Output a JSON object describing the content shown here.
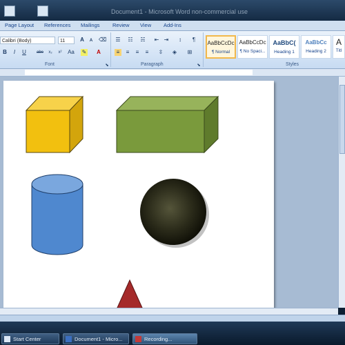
{
  "window": {
    "title": "Document1 - Microsoft Word non-commercial use"
  },
  "ribbon_tabs": [
    {
      "label": "Page Layout"
    },
    {
      "label": "References"
    },
    {
      "label": "Mailings"
    },
    {
      "label": "Review"
    },
    {
      "label": "View"
    },
    {
      "label": "Add-Ins"
    }
  ],
  "font_group": {
    "label": "Font",
    "font_name": "Calibri (Body)",
    "font_size": "11",
    "bold": "B",
    "italic": "I",
    "underline": "U",
    "strike": "abe",
    "subscript": "x₂",
    "superscript": "x²",
    "grow": "A",
    "shrink": "A",
    "font_color": "A"
  },
  "paragraph_group": {
    "label": "Paragraph"
  },
  "styles_group": {
    "label": "Styles",
    "styles": [
      {
        "sample": "AaBbCcDc",
        "name": "¶ Normal",
        "selected": true
      },
      {
        "sample": "AaBbCcDc",
        "name": "¶ No Spaci...",
        "selected": false
      },
      {
        "sample": "AaBbC(",
        "name": "Heading 1",
        "selected": false
      },
      {
        "sample": "AaBbCc",
        "name": "Heading 2",
        "selected": false
      },
      {
        "sample": "A",
        "name": "Titl",
        "selected": false
      }
    ]
  },
  "shapes": {
    "cube_color": "#f2c00f",
    "box_color": "#7a9a3c",
    "cylinder_color": "#4f88cf",
    "sphere_color": "#2b2b1a",
    "triangle_color": "#a52a2a"
  },
  "taskbar": {
    "items": [
      {
        "label": "Start Center"
      },
      {
        "label": "Document1 - Micro..."
      },
      {
        "label": "Recording..."
      }
    ]
  }
}
